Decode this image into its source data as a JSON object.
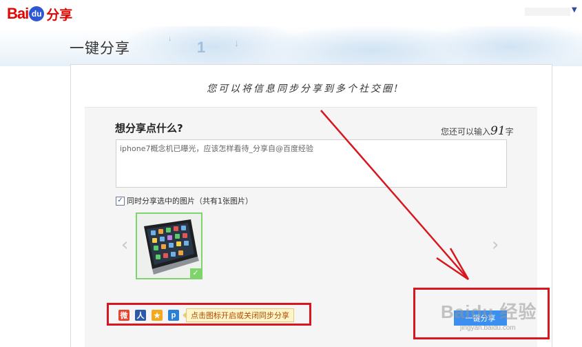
{
  "header": {
    "logo_text": "Bai",
    "logo_paw": "du",
    "logo_suffix": "分享"
  },
  "page": {
    "title": "一键分享",
    "tagline": "您可以将信息同步分享到多个社交圈!"
  },
  "composer": {
    "prompt": "想分享点什么?",
    "count_prefix": "您还可以输入",
    "count_value": "91",
    "count_suffix": "字",
    "text_value": "iphone7概念机已曝光，应该怎样看待_分享自@百度经验",
    "image_checkbox_label": "同时分享选中的图片（共有1张图片）",
    "image_checkbox_checked": true,
    "prev_arrow": "‹",
    "next_arrow": "›",
    "thumb_check": "✓"
  },
  "social": {
    "icons": [
      {
        "name": "weibo-icon",
        "glyph": "微",
        "color": "#e8412c"
      },
      {
        "name": "renren-icon",
        "glyph": "人",
        "color": "#2c5aa9"
      },
      {
        "name": "qzone-icon",
        "glyph": "★",
        "color": "#f4a81d"
      },
      {
        "name": "tqq-icon",
        "glyph": "p",
        "color": "#2b7fd5"
      }
    ],
    "tooltip": "点击图标开启或关闭同步分享"
  },
  "actions": {
    "share_label": "一键分享"
  },
  "watermark": {
    "brand": "Baidu 经验",
    "url": "jingyan.baidu.com"
  },
  "colors": {
    "annotation": "#d8161d",
    "accent": "#3a8ff0",
    "brand_red": "#e10601",
    "brand_blue": "#2d57d3"
  }
}
